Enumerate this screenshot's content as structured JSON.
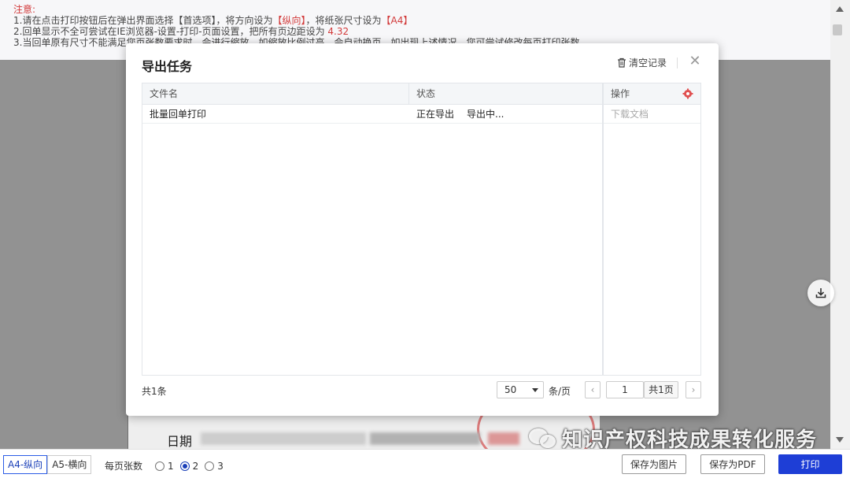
{
  "notice": {
    "title": "注意:",
    "line1_pre": "1.请在点击打印按钮后在弹出界面选择【首选项】，将方向设为",
    "line1_hl1": "【纵向】",
    "line1_mid": "，将纸张尺寸设为",
    "line1_hl2": "【A4】",
    "line2_pre": "2.回单显示不全可尝试在IE浏览器-设置-打印-页面设置，把所有页边距设为",
    "line2_hl": "4.32",
    "line3": "3.当回单原有尺寸不能满足您页张数要求时，会进行缩放，如缩放比例过高，会自动换页，如出现上述情况，您可尝试修改每页打印张数"
  },
  "document": {
    "date_label": "日期"
  },
  "watermark": {
    "text": "知识产权科技成果转化服务"
  },
  "modal": {
    "title": "导出任务",
    "clear_label": "清空记录",
    "close_symbol": "✕",
    "columns": {
      "filename": "文件名",
      "status": "状态",
      "ops": "操作"
    },
    "rows": [
      {
        "filename": "批量回单打印",
        "status": "正在导出",
        "progress": "导出中...",
        "action": "下载文档"
      }
    ],
    "footer": {
      "total": "共1条",
      "page_size": "50",
      "per_page_label": "条/页",
      "prev": "‹",
      "page_value": "1",
      "page_total": "共1页",
      "next": "›"
    }
  },
  "bottom_bar": {
    "orient_a4": "A4-纵向",
    "orient_a5": "A5-横向",
    "per_page_label": "每页张数",
    "options": [
      "1",
      "2",
      "3"
    ],
    "selected_option": "2",
    "save_image": "保存为图片",
    "save_pdf": "保存为PDF",
    "print": "打印"
  },
  "colors": {
    "accent": "#1e3ed6",
    "notice_highlight": "#d23a3a"
  },
  "icons": {
    "clear": "trash-icon",
    "close": "close-icon",
    "settings": "gear-icon",
    "download": "download-icon",
    "select": "chevron-down-icon",
    "watermark": "wechat-icon"
  }
}
